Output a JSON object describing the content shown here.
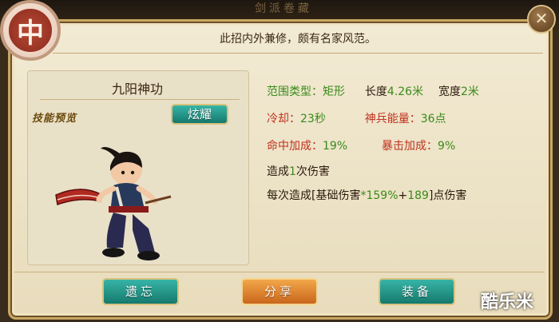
{
  "background": {
    "title": "剑派卷藏"
  },
  "medallion": {
    "glyph": "中"
  },
  "header": {
    "description": "此招内外兼修，颇有名家风范。"
  },
  "close": {
    "icon": "close-icon",
    "glyph": "✕"
  },
  "skill": {
    "name": "九阳神功",
    "preview_label": "技能预览",
    "flaunt_button": "炫耀"
  },
  "stats": {
    "range_type_label": "范围类型：",
    "range_type_value": "矩形",
    "length_label": "长度",
    "length_value": "4.26米",
    "width_label": "宽度",
    "width_value": "2米",
    "cooldown_label": "冷却：",
    "cooldown_value": "23秒",
    "weapon_energy_label": "神兵能量：",
    "weapon_energy_value": "36点",
    "hit_bonus_label": "命中加成：",
    "hit_bonus_value": "19%",
    "crit_bonus_label": "暴击加成：",
    "crit_bonus_value": "9%",
    "damage_count_prefix": "造成",
    "damage_count_value": "1",
    "damage_count_suffix": "次伤害",
    "per_hit_prefix": "每次造成[基础伤害",
    "per_hit_percent": "*159%",
    "per_hit_plus": "+",
    "per_hit_flat": "189",
    "per_hit_suffix": "]点伤害"
  },
  "footer": {
    "forget_button": "遗忘",
    "share_button": "分享",
    "equip_button": "装备"
  },
  "watermark_logo": "酷乐米",
  "colors": {
    "accent_green": "#3a8a1a",
    "accent_red": "#c0321e",
    "button_teal": "#1f9385",
    "button_orange": "#e08a32"
  }
}
